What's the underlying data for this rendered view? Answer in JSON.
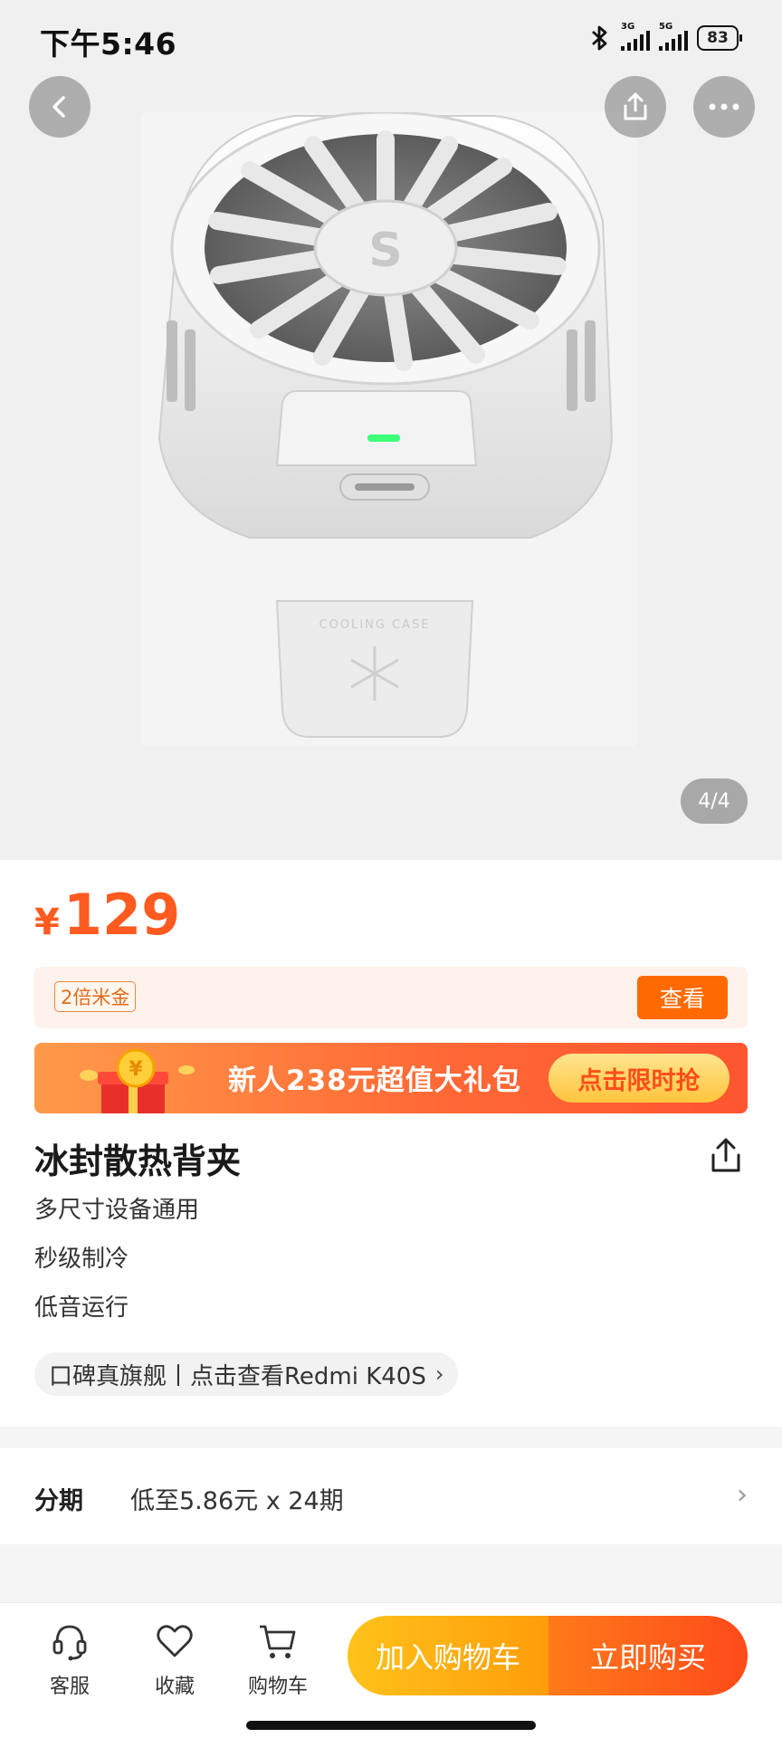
{
  "status_bar": {
    "time": "下午5:46",
    "network_1": "3G",
    "network_2": "5G",
    "battery": "83"
  },
  "gallery": {
    "page_indicator": "4/4",
    "product_print": "COOLING CASE",
    "icons": [
      "back-arrow-icon",
      "share-icon",
      "more-icon"
    ]
  },
  "product": {
    "currency": "¥",
    "price": "129",
    "coin_tag": "2倍米金",
    "view_label": "查看",
    "banner_text": "新人238元超值大礼包",
    "banner_button": "点击限时抢",
    "title": "冰封散热背夹",
    "features": [
      "多尺寸设备通用",
      "秒级制冷",
      "低音运行"
    ],
    "flagship_text": "口碑真旗舰丨点击查看Redmi K40S"
  },
  "installment": {
    "label": "分期",
    "value": "低至5.86元 x 24期"
  },
  "bottom_bar": {
    "service": "客服",
    "favorite": "收藏",
    "cart": "购物车",
    "add_to_cart": "加入购物车",
    "buy_now": "立即购买"
  },
  "colors": {
    "price": "#ff5a1f",
    "add_to_cart": "#ffb514",
    "buy_now": "#ff5a1a",
    "led": "#3cff7a"
  }
}
